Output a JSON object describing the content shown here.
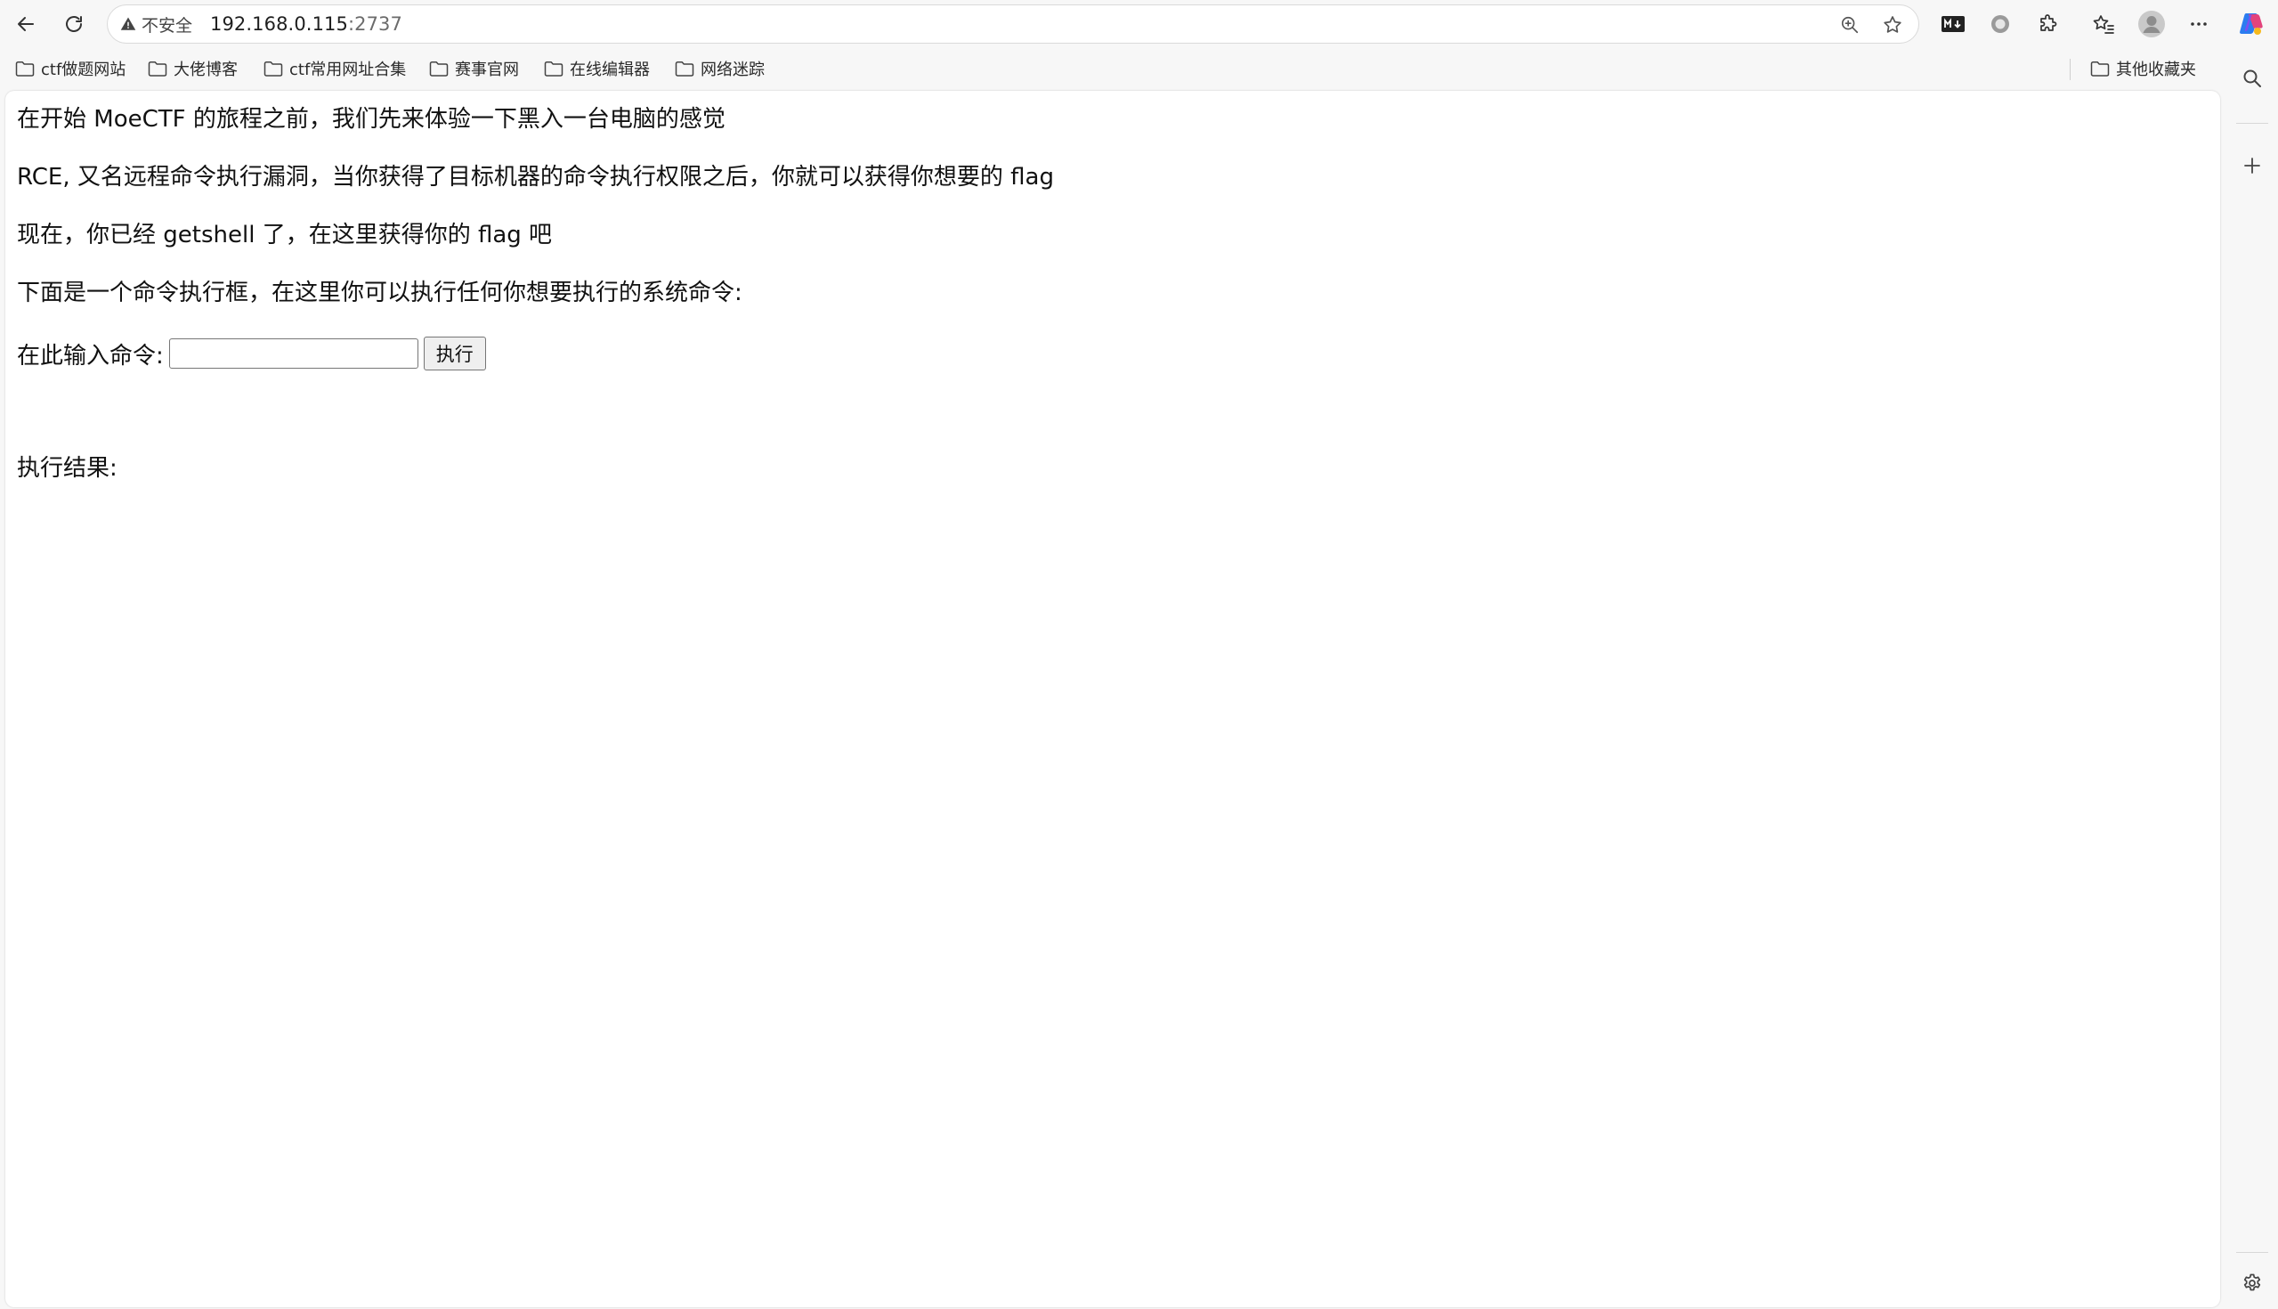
{
  "browser": {
    "security_label": "不安全",
    "url_host": "192.168.0.115",
    "url_port": ":2737",
    "toolbar_badge": "M↓"
  },
  "bookmarks": [
    {
      "label": "ctf做题网站"
    },
    {
      "label": "大佬博客"
    },
    {
      "label": "ctf常用网址合集"
    },
    {
      "label": "赛事官网"
    },
    {
      "label": "在线编辑器"
    },
    {
      "label": "网络迷踪"
    }
  ],
  "other_bookmarks": "其他收藏夹",
  "page": {
    "line1": "在开始 MoeCTF 的旅程之前，我们先来体验一下黑入一台电脑的感觉",
    "line2": "RCE, 又名远程命令执行漏洞，当你获得了目标机器的命令执行权限之后，你就可以获得你想要的 flag",
    "line3": "现在，你已经 getshell 了，在这里获得你的 flag 吧",
    "line4": "下面是一个命令执行框，在这里你可以执行任何你想要执行的系统命令:",
    "input_label": "在此输入命令:",
    "input_value": "",
    "submit_label": "执行",
    "result_label": "执行结果:"
  },
  "colors": {
    "page_bg": "#ffffff",
    "chrome_bg": "#f7f7f7",
    "text": "#111111"
  }
}
